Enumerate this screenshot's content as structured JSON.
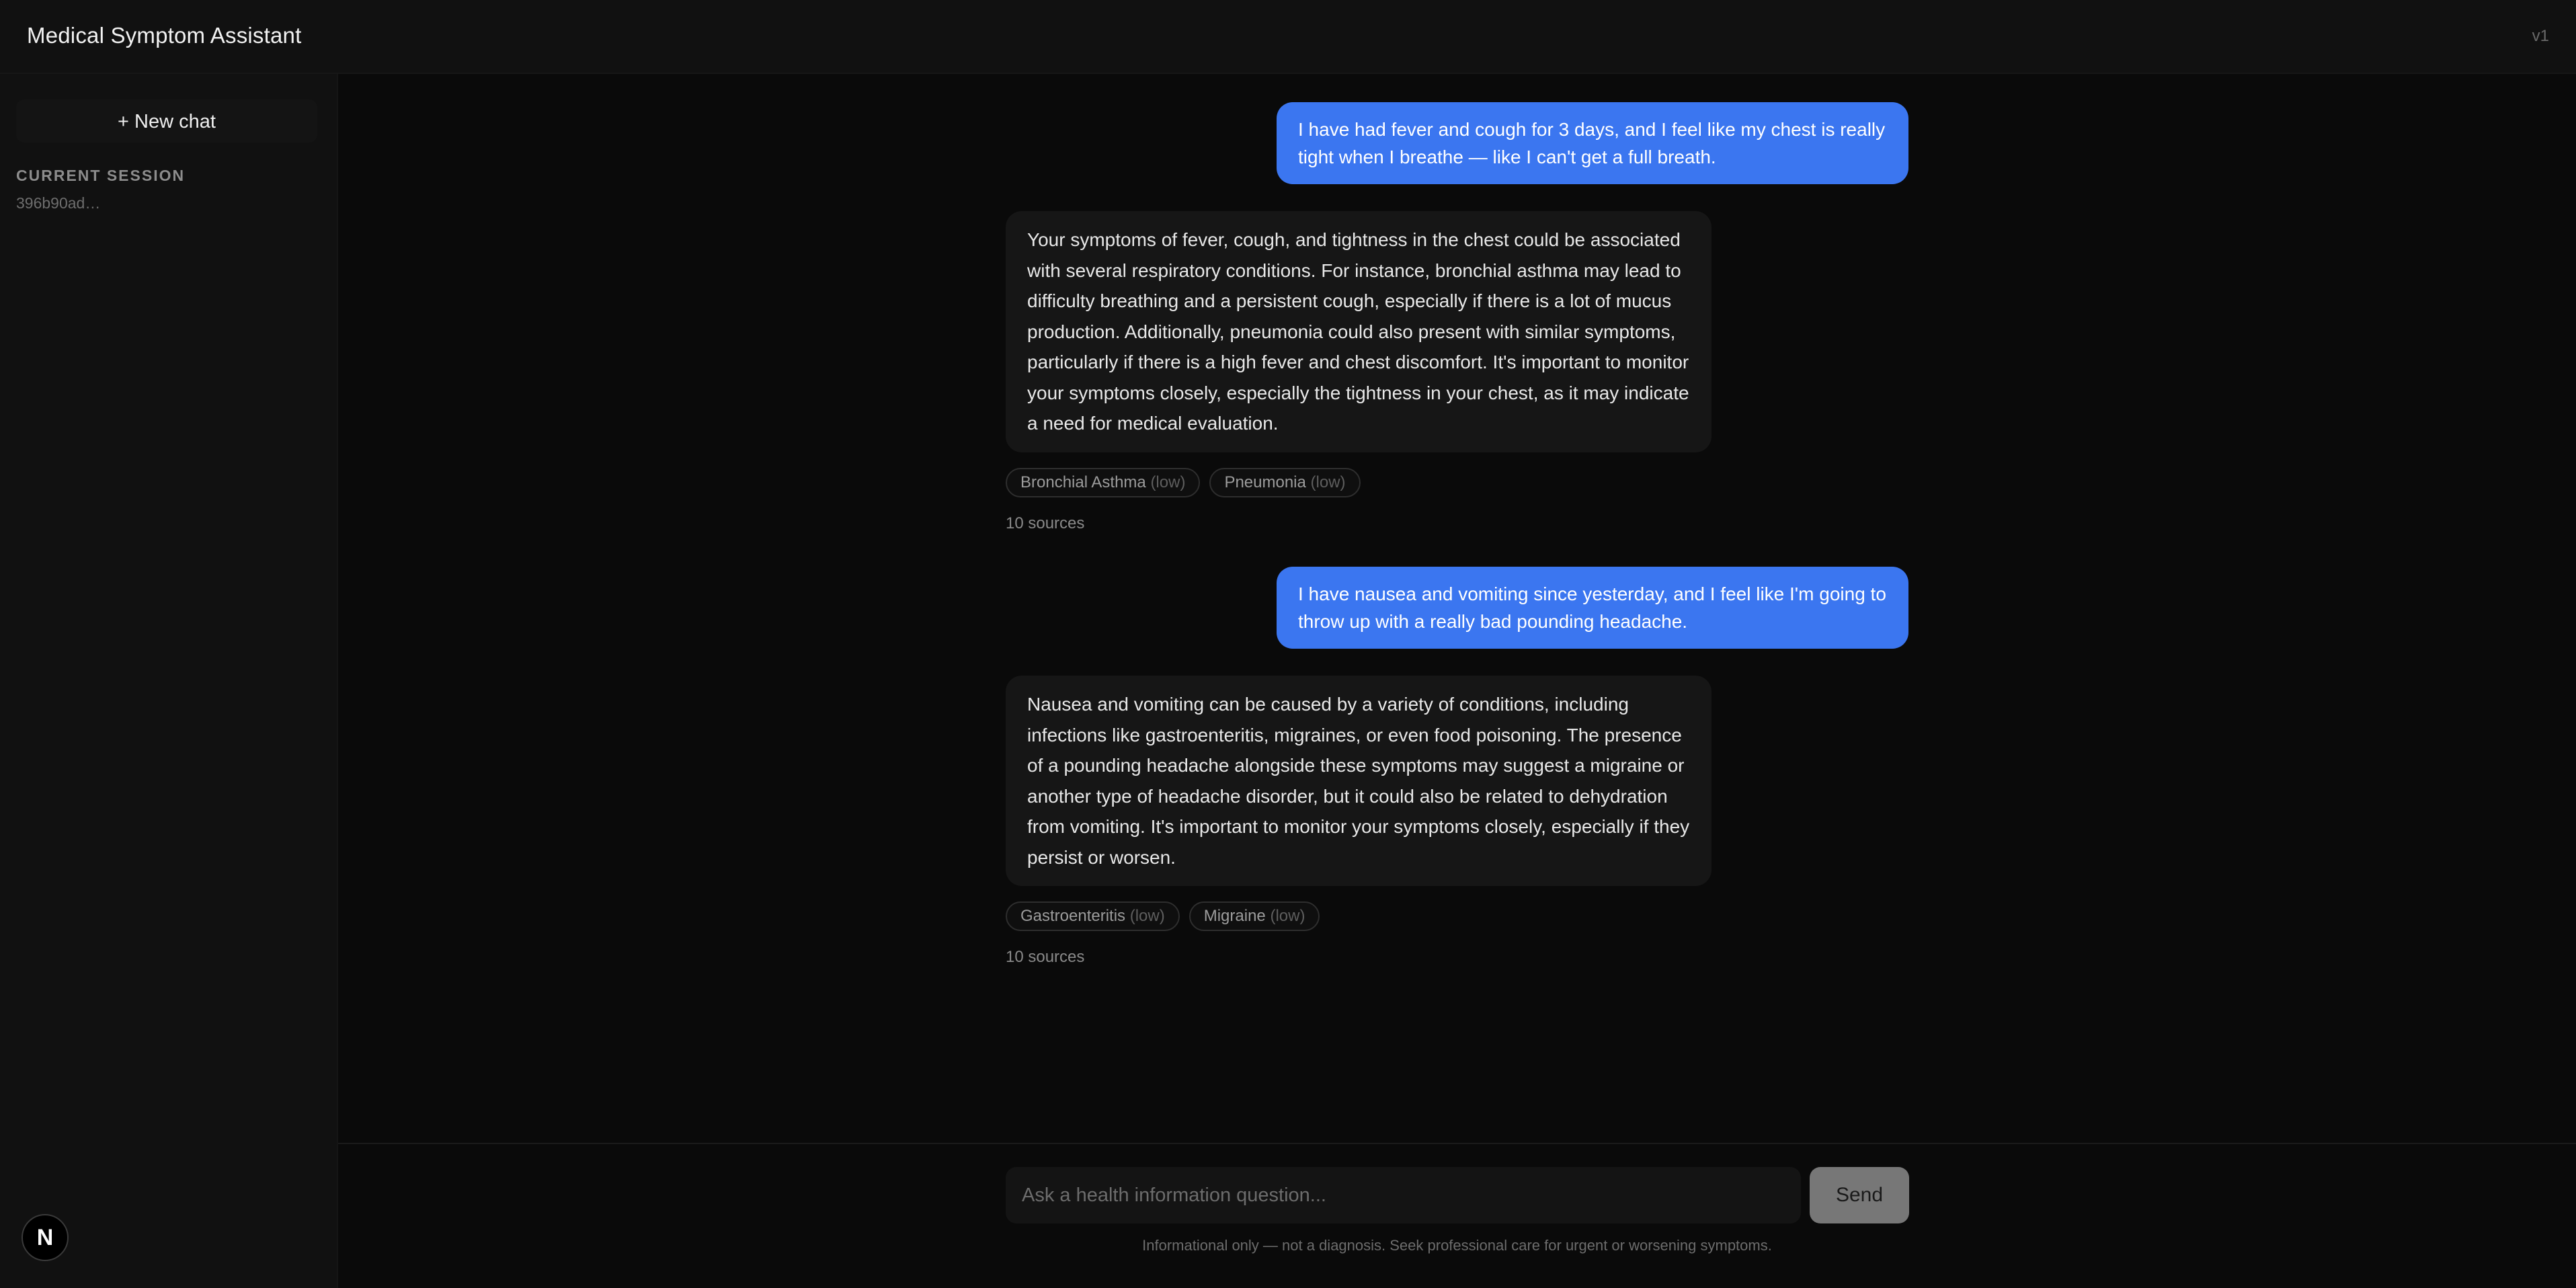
{
  "header": {
    "title": "Medical Symptom Assistant",
    "version": "v1"
  },
  "sidebar": {
    "new_chat_label": "+ New chat",
    "session_label": "CURRENT SESSION",
    "session_id": "396b90ad…",
    "logo_letter": "N"
  },
  "messages": [
    {
      "role": "user",
      "text": "I have had fever and cough for 3 days, and I feel like my chest is really tight when I breathe — like I can't get a full breath."
    },
    {
      "role": "assistant",
      "text": "Your symptoms of fever, cough, and tightness in the chest could be associated with several respiratory conditions. For instance, bronchial asthma may lead to difficulty breathing and a persistent cough, especially if there is a lot of mucus production. Additionally, pneumonia could also present with similar symptoms, particularly if there is a high fever and chest discomfort. It's important to monitor your symptoms closely, especially the tightness in your chest, as it may indicate a need for medical evaluation.",
      "conditions": [
        {
          "name": "Bronchial Asthma",
          "level": "(low)"
        },
        {
          "name": "Pneumonia",
          "level": "(low)"
        }
      ],
      "sources": "10 sources"
    },
    {
      "role": "user",
      "text": "I have nausea and vomiting since yesterday, and I feel like I'm going to throw up with a really bad pounding headache."
    },
    {
      "role": "assistant",
      "text": "Nausea and vomiting can be caused by a variety of conditions, including infections like gastroenteritis, migraines, or even food poisoning. The presence of a pounding headache alongside these symptoms may suggest a migraine or another type of headache disorder, but it could also be related to dehydration from vomiting. It's important to monitor your symptoms closely, especially if they persist or worsen.",
      "conditions": [
        {
          "name": "Gastroenteritis",
          "level": "(low)"
        },
        {
          "name": "Migraine",
          "level": "(low)"
        }
      ],
      "sources": "10 sources"
    }
  ],
  "composer": {
    "placeholder": "Ask a health information question...",
    "value": "",
    "send_label": "Send",
    "disclaimer": "Informational only — not a diagnosis. Seek professional care for urgent or worsening symptoms."
  },
  "colors": {
    "user_bubble": "#3b76f0",
    "assistant_bubble": "#161616",
    "send_button": "#777777"
  }
}
